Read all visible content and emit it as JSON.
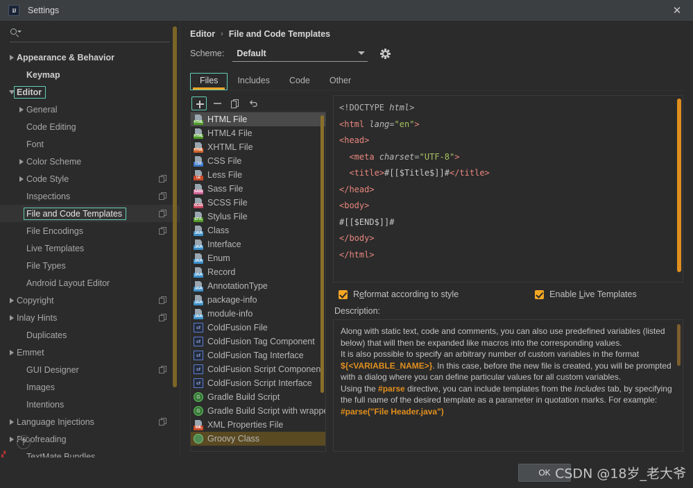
{
  "window": {
    "title": "Settings",
    "logo_text": "IJ",
    "close_icon": "✕"
  },
  "sidebar": {
    "search_placeholder": "",
    "search_value": "",
    "help_label": "?",
    "items": [
      {
        "label": "Appearance & Behavior",
        "level": 0,
        "arrow": "right",
        "bold": true,
        "copy": false
      },
      {
        "label": "Keymap",
        "level": 1,
        "arrow": "none",
        "bold": true,
        "copy": false
      },
      {
        "label": "Editor",
        "level": 0,
        "arrow": "down",
        "bold": true,
        "copy": false,
        "focused": true
      },
      {
        "label": "General",
        "level": 1,
        "arrow": "right",
        "bold": false,
        "copy": false
      },
      {
        "label": "Code Editing",
        "level": 1,
        "arrow": "none",
        "bold": false,
        "copy": false
      },
      {
        "label": "Font",
        "level": 1,
        "arrow": "none",
        "bold": false,
        "copy": false
      },
      {
        "label": "Color Scheme",
        "level": 1,
        "arrow": "right",
        "bold": false,
        "copy": false
      },
      {
        "label": "Code Style",
        "level": 1,
        "arrow": "right",
        "bold": false,
        "copy": true
      },
      {
        "label": "Inspections",
        "level": 1,
        "arrow": "none",
        "bold": false,
        "copy": true
      },
      {
        "label": "File and Code Templates",
        "level": 1,
        "arrow": "none",
        "bold": false,
        "copy": true,
        "selected": true,
        "focused": true
      },
      {
        "label": "File Encodings",
        "level": 1,
        "arrow": "none",
        "bold": false,
        "copy": true
      },
      {
        "label": "Live Templates",
        "level": 1,
        "arrow": "none",
        "bold": false,
        "copy": false
      },
      {
        "label": "File Types",
        "level": 1,
        "arrow": "none",
        "bold": false,
        "copy": false
      },
      {
        "label": "Android Layout Editor",
        "level": 1,
        "arrow": "none",
        "bold": false,
        "copy": false
      },
      {
        "label": "Copyright",
        "level": 0,
        "arrow": "right",
        "bold": false,
        "copy": true
      },
      {
        "label": "Inlay Hints",
        "level": 0,
        "arrow": "right",
        "bold": false,
        "copy": true
      },
      {
        "label": "Duplicates",
        "level": 1,
        "arrow": "none",
        "bold": false,
        "copy": false
      },
      {
        "label": "Emmet",
        "level": 0,
        "arrow": "right",
        "bold": false,
        "copy": false
      },
      {
        "label": "GUI Designer",
        "level": 1,
        "arrow": "none",
        "bold": false,
        "copy": true
      },
      {
        "label": "Images",
        "level": 1,
        "arrow": "none",
        "bold": false,
        "copy": false
      },
      {
        "label": "Intentions",
        "level": 1,
        "arrow": "none",
        "bold": false,
        "copy": false
      },
      {
        "label": "Language Injections",
        "level": 0,
        "arrow": "right",
        "bold": false,
        "copy": true
      },
      {
        "label": "Proofreading",
        "level": 0,
        "arrow": "right",
        "bold": false,
        "copy": false
      },
      {
        "label": "TextMate Bundles",
        "level": 1,
        "arrow": "none",
        "bold": false,
        "copy": false
      }
    ]
  },
  "breadcrumb": {
    "root": "Editor",
    "separator": "›",
    "current": "File and Code Templates"
  },
  "scheme": {
    "label": "Scheme:",
    "value": "Default",
    "gear_icon": "gear-icon",
    "chevron_icon": "chevron-down-icon"
  },
  "tabs": [
    {
      "label": "Files",
      "active": true,
      "focused": true
    },
    {
      "label": "Includes",
      "active": false,
      "focused": false
    },
    {
      "label": "Code",
      "active": false,
      "focused": false
    },
    {
      "label": "Other",
      "active": false,
      "focused": false
    }
  ],
  "list_toolbar": [
    {
      "name": "add-template-button",
      "icon": "plus-icon",
      "focused": true
    },
    {
      "name": "remove-template-button",
      "icon": "minus-icon",
      "focused": false
    },
    {
      "name": "copy-template-button",
      "icon": "copy-icon",
      "focused": false
    },
    {
      "name": "reset-template-button",
      "icon": "undo-icon",
      "focused": false
    }
  ],
  "templates": [
    {
      "label": "HTML File",
      "icon": "html-file-icon",
      "badge": "HTML",
      "badge_color": "#4f9b28",
      "selected": true
    },
    {
      "label": "HTML4 File",
      "icon": "html4-file-icon",
      "badge": "HTML",
      "badge_color": "#4f9b28"
    },
    {
      "label": "XHTML File",
      "icon": "xhtml-file-icon",
      "badge": "HTML",
      "badge_color": "#d1632a"
    },
    {
      "label": "CSS File",
      "icon": "css-file-icon",
      "badge": "CSS",
      "badge_color": "#3c78c8"
    },
    {
      "label": "Less File",
      "icon": "less-file-icon",
      "badge": "LE",
      "badge_color": "#c94b2a"
    },
    {
      "label": "Sass File",
      "icon": "sass-file-icon",
      "badge": "SASS",
      "badge_color": "#cf5f92"
    },
    {
      "label": "SCSS File",
      "icon": "scss-file-icon",
      "badge": "SCSS",
      "badge_color": "#c4455f"
    },
    {
      "label": "Stylus File",
      "icon": "stylus-file-icon",
      "badge": "STYL",
      "badge_color": "#4f9b28"
    },
    {
      "label": "Class",
      "icon": "java-class-icon",
      "badge": "JAVA",
      "badge_color": "#3c8fc8"
    },
    {
      "label": "Interface",
      "icon": "java-interface-icon",
      "badge": "JAVA",
      "badge_color": "#3c8fc8"
    },
    {
      "label": "Enum",
      "icon": "java-enum-icon",
      "badge": "JAVA",
      "badge_color": "#3c8fc8"
    },
    {
      "label": "Record",
      "icon": "java-record-icon",
      "badge": "JAVA",
      "badge_color": "#3c8fc8"
    },
    {
      "label": "AnnotationType",
      "icon": "java-annotation-icon",
      "badge": "JAVA",
      "badge_color": "#3c8fc8"
    },
    {
      "label": "package-info",
      "icon": "package-info-icon",
      "badge": "JAVA",
      "badge_color": "#3c8fc8"
    },
    {
      "label": "module-info",
      "icon": "module-info-icon",
      "badge": "JAVA",
      "badge_color": "#3c8fc8"
    },
    {
      "label": "ColdFusion File",
      "icon": "coldfusion-icon",
      "badge": "cf"
    },
    {
      "label": "ColdFusion Tag Component",
      "icon": "coldfusion-icon",
      "badge": "cf"
    },
    {
      "label": "ColdFusion Tag Interface",
      "icon": "coldfusion-icon",
      "badge": "cf"
    },
    {
      "label": "ColdFusion Script Component",
      "icon": "coldfusion-icon",
      "badge": "cf"
    },
    {
      "label": "ColdFusion Script Interface",
      "icon": "coldfusion-icon",
      "badge": "cf"
    },
    {
      "label": "Gradle Build Script",
      "icon": "gradle-icon",
      "badge": "G"
    },
    {
      "label": "Gradle Build Script with wrappe",
      "icon": "gradle-icon",
      "badge": "G"
    },
    {
      "label": "XML Properties File",
      "icon": "xml-properties-icon",
      "badge": "XML",
      "badge_color": "#c94b2a"
    },
    {
      "label": "Groovy Class",
      "icon": "groovy-icon",
      "badge": "",
      "highlighted": true
    }
  ],
  "code_editor": {
    "lines": [
      [
        {
          "t": "<!DOCTYPE ",
          "c": "tk-doct"
        },
        {
          "t": "html",
          "c": "tk-attr"
        },
        {
          "t": ">",
          "c": "tk-doct"
        }
      ],
      [
        {
          "t": "<",
          "c": "tk-tagred"
        },
        {
          "t": "html",
          "c": "tk-tagred"
        },
        {
          "t": " ",
          "c": "tk-plain"
        },
        {
          "t": "lang",
          "c": "tk-attr"
        },
        {
          "t": "=",
          "c": "tk-punct"
        },
        {
          "t": "\"en\"",
          "c": "tk-str"
        },
        {
          "t": ">",
          "c": "tk-tagred"
        }
      ],
      [
        {
          "t": "<",
          "c": "tk-tagred"
        },
        {
          "t": "head",
          "c": "tk-tagred"
        },
        {
          "t": ">",
          "c": "tk-tagred"
        }
      ],
      [
        {
          "t": "  <",
          "c": "tk-tagred"
        },
        {
          "t": "meta",
          "c": "tk-tagred"
        },
        {
          "t": " ",
          "c": "tk-plain"
        },
        {
          "t": "charset",
          "c": "tk-attr"
        },
        {
          "t": "=",
          "c": "tk-punct"
        },
        {
          "t": "\"UTF-8\"",
          "c": "tk-str"
        },
        {
          "t": ">",
          "c": "tk-tagred"
        }
      ],
      [
        {
          "t": "  <",
          "c": "tk-tagred"
        },
        {
          "t": "title",
          "c": "tk-tagred"
        },
        {
          "t": ">",
          "c": "tk-tagred"
        },
        {
          "t": "#[[$Title$]]#",
          "c": "tk-plain"
        },
        {
          "t": "</",
          "c": "tk-tagred"
        },
        {
          "t": "title",
          "c": "tk-tagred"
        },
        {
          "t": ">",
          "c": "tk-tagred"
        }
      ],
      [
        {
          "t": "</",
          "c": "tk-tagred"
        },
        {
          "t": "head",
          "c": "tk-tagred"
        },
        {
          "t": ">",
          "c": "tk-tagred"
        }
      ],
      [
        {
          "t": "<",
          "c": "tk-tagred"
        },
        {
          "t": "body",
          "c": "tk-tagred"
        },
        {
          "t": ">",
          "c": "tk-tagred"
        }
      ],
      [
        {
          "t": "#[[$END$]]#",
          "c": "tk-plain"
        }
      ],
      [
        {
          "t": "</",
          "c": "tk-tagred"
        },
        {
          "t": "body",
          "c": "tk-tagred"
        },
        {
          "t": ">",
          "c": "tk-tagred"
        }
      ],
      [
        {
          "t": "</",
          "c": "tk-tagred"
        },
        {
          "t": "html",
          "c": "tk-tagred"
        },
        {
          "t": ">",
          "c": "tk-tagred"
        }
      ]
    ]
  },
  "checkboxes": [
    {
      "label_pre": "R",
      "label_mn": "e",
      "label_post": "format according to style",
      "checked": true,
      "name": "reformat-according-to-style-checkbox"
    },
    {
      "label_pre": "Enable ",
      "label_mn": "L",
      "label_post": "ive Templates",
      "checked": true,
      "name": "enable-live-templates-checkbox"
    }
  ],
  "description": {
    "label": "Description:",
    "paragraphs": [
      [
        {
          "t": "Along with static text, code and comments, you can also use predefined variables (listed below) that will then be expanded like macros into the corresponding values.",
          "c": ""
        }
      ],
      [
        {
          "t": "It is also possible to specify an arbitrary number of custom variables in the format ",
          "c": ""
        },
        {
          "t": "${<VARIABLE_NAME>}",
          "c": "d-orange"
        },
        {
          "t": ". In this case, before the new file is created, you will be prompted with a dialog where you can define particular values for all custom variables.",
          "c": ""
        }
      ],
      [
        {
          "t": "Using the ",
          "c": ""
        },
        {
          "t": "#parse",
          "c": "d-orange"
        },
        {
          "t": " directive, you can include templates from the ",
          "c": ""
        },
        {
          "t": "Includes",
          "c": "d-ital"
        },
        {
          "t": " tab, by specifying the full name of the desired template as a parameter in quotation marks. For example:",
          "c": ""
        }
      ],
      [
        {
          "t": "#parse(\"File Header.java\")",
          "c": "d-orange"
        }
      ]
    ]
  },
  "footer": {
    "ok_label": "OK",
    "watermark": "CSDN @18岁_老大爷"
  },
  "colors": {
    "accent_orange": "#f5a623",
    "focus_teal": "#63d0b6",
    "background": "#2b2b2b",
    "titlebar": "#3c3f41",
    "selection": "#4a4a4a"
  }
}
